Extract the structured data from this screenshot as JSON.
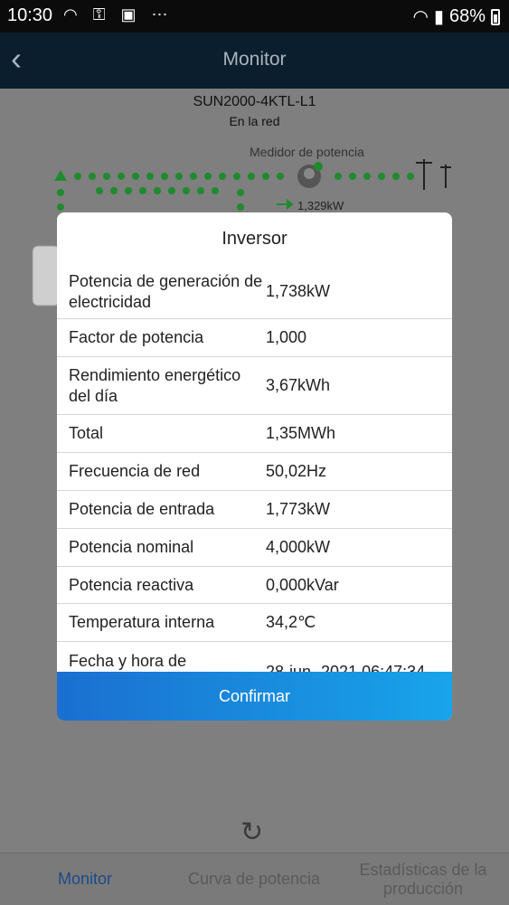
{
  "status_bar": {
    "time": "10:30",
    "battery": "68%",
    "left_icons": [
      "wifi-icon",
      "vpn-icon",
      "image-icon",
      "more-icon"
    ],
    "right_icons": [
      "wifi-icon",
      "signal-icon",
      "battery-icon"
    ]
  },
  "app_bar": {
    "title": "Monitor"
  },
  "device": {
    "model": "SUN2000-4KTL-L1",
    "status": "En la red"
  },
  "diagram": {
    "meter_label": "Medidor de potencia",
    "meter_power": "1,329kW"
  },
  "modal": {
    "title": "Inversor",
    "rows": [
      {
        "label": "Potencia de generación de electricidad",
        "value": "1,738kW"
      },
      {
        "label": "Factor de potencia",
        "value": "1,000"
      },
      {
        "label": "Rendimiento energético del día",
        "value": "3,67kWh"
      },
      {
        "label": "Total",
        "value": "1,35MWh"
      },
      {
        "label": "Frecuencia de red",
        "value": "50,02Hz"
      },
      {
        "label": "Potencia de entrada",
        "value": "1,773kW"
      },
      {
        "label": "Potencia nominal",
        "value": "4,000kW"
      },
      {
        "label": "Potencia reactiva",
        "value": "0,000kVar"
      },
      {
        "label": "Temperatura interna",
        "value": "34,2℃"
      },
      {
        "label": "Fecha y hora de",
        "value": "28-jun.-2021 06:47:34"
      }
    ],
    "confirm_label": "Confirmar"
  },
  "tabs": [
    {
      "label": "Monitor",
      "active": true
    },
    {
      "label": "Curva de potencia",
      "active": false
    },
    {
      "label": "Estadísticas de la producción",
      "active": false
    }
  ],
  "colors": {
    "accent_tab": "#1b4a8a",
    "confirm_start": "#1a6fd0",
    "confirm_end": "#18a4ea",
    "flow_dots": "#1f8a2e"
  }
}
